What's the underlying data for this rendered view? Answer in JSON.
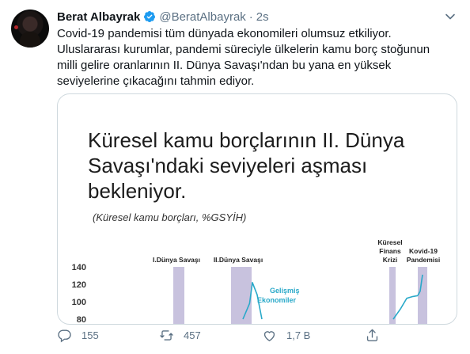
{
  "tweet": {
    "author_name": "Berat Albayrak",
    "handle": "@BeratAlbayrak",
    "separator": "·",
    "time": "2s",
    "text": "Covid-19 pandemisi tüm dünyada ekonomileri olumsuz etkiliyor. Uluslararası kurumlar, pandemi süreciyle ülkelerin kamu borç stoğunun milli gelire oranlarının II. Dünya Savaşı'ndan bu yana en yüksek seviyelerine çıkacağını tahmin ediyor."
  },
  "card": {
    "title": "Küresel kamu borçlarının II. Dünya Savaşı'ndaki seviyeleri aşması bekleniyor.",
    "subtitle": "(Küresel kamu borçları, %GSYİH)"
  },
  "chart_data": {
    "type": "line",
    "title": "Küresel kamu borçlarının II. Dünya Savaşı'ndaki seviyeleri aşması bekleniyor.",
    "subtitle": "(Küresel kamu borçları, %GSYİH)",
    "yticks": [
      140,
      120,
      100,
      80
    ],
    "ylim": [
      80,
      140
    ],
    "period_labels": [
      "I.Dünya Savaşı",
      "II.Dünya Savaşı",
      "Küresel Finans Krizi",
      "Kovid-19 Pandemisi"
    ],
    "series": [
      {
        "name": "Gelişmiş Ekonomiler",
        "color": "#29a9c9",
        "visible_fragments": [
          [
            [
              0.0,
              80
            ],
            [
              0.35,
              98
            ],
            [
              0.5,
              122
            ],
            [
              0.75,
              108
            ],
            [
              1.0,
              80
            ]
          ],
          [
            [
              0.0,
              80
            ],
            [
              0.3,
              92
            ],
            [
              0.55,
              104
            ],
            [
              0.8,
              106
            ],
            [
              1.0,
              107
            ]
          ],
          [
            [
              0.0,
              107
            ],
            [
              0.5,
              112
            ],
            [
              1.0,
              131
            ]
          ]
        ]
      }
    ],
    "colors": {
      "shade": "#c8c2de",
      "line": "#29a9c9"
    }
  },
  "actions": {
    "reply_count": "155",
    "retweet_count": "457",
    "like_count": "1,7 B"
  },
  "colors": {
    "verified": "#1d9bf0",
    "muted": "#5b7083",
    "border": "#cfd9de"
  }
}
